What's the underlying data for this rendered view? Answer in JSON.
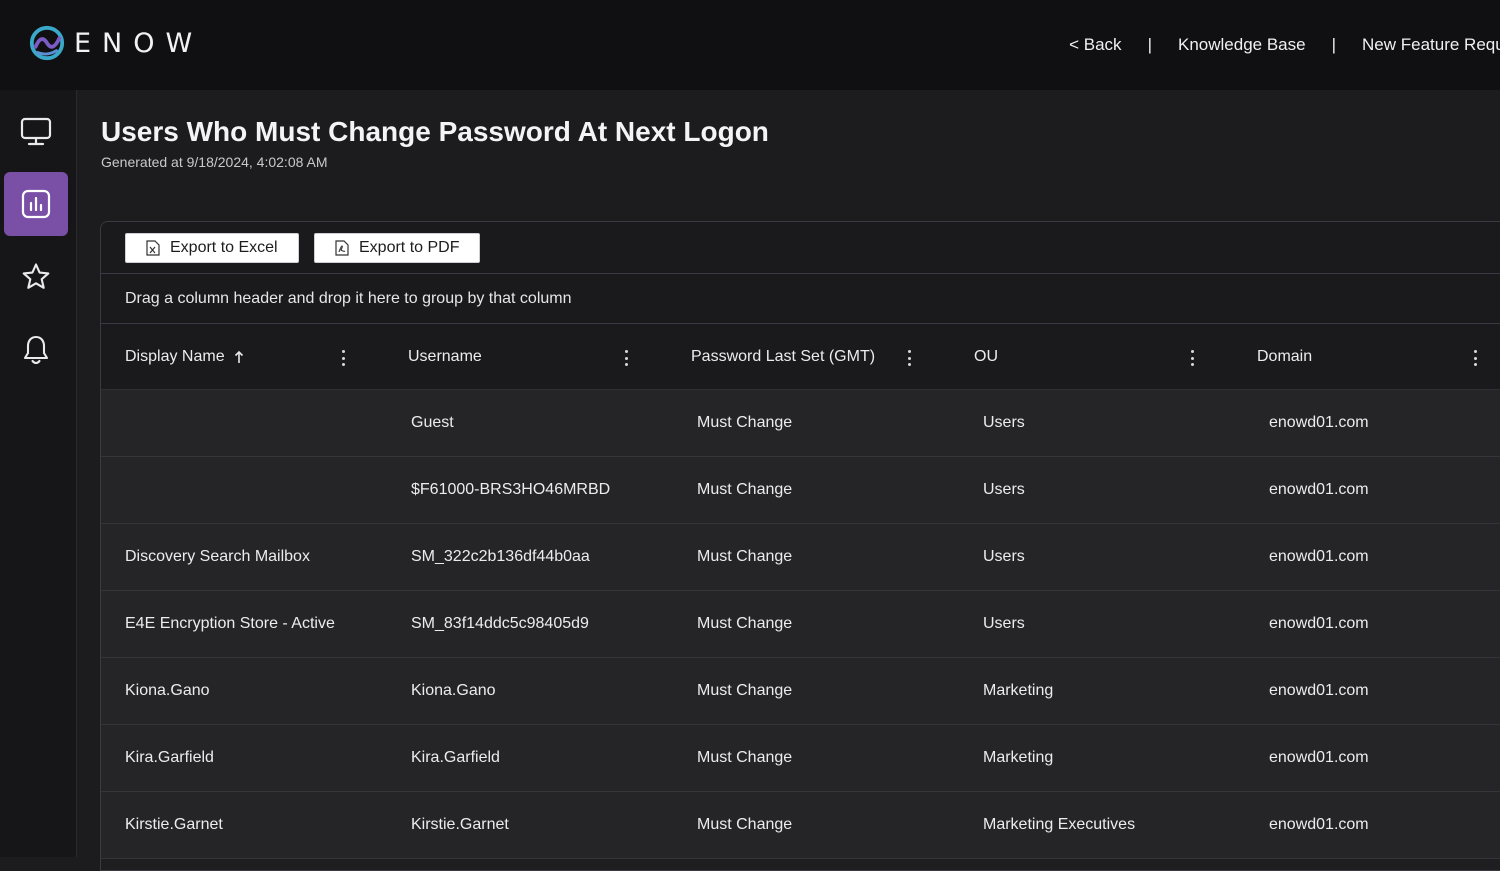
{
  "brand": {
    "name": "ENOW"
  },
  "topnav": {
    "back": "< Back",
    "separator": "|",
    "knowledge_base": "Knowledge Base",
    "feature_request": "New Feature Requ"
  },
  "sidebar": {
    "items": [
      {
        "icon": "monitor-icon",
        "active": false
      },
      {
        "icon": "reports-chart-icon",
        "active": true
      },
      {
        "icon": "star-icon",
        "active": false
      },
      {
        "icon": "bell-icon",
        "active": false
      }
    ],
    "accent": "#7a4fa6"
  },
  "page": {
    "title": "Users Who Must Change Password At Next Logon",
    "subtitle": "Generated at 9/18/2024, 4:02:08 AM"
  },
  "toolbar": {
    "export_excel": "Export to Excel",
    "export_pdf": "Export to PDF"
  },
  "grid": {
    "group_hint": "Drag a column header and drop it here to group by that column",
    "columns": [
      "Display Name",
      "Username",
      "Password Last Set (GMT)",
      "OU",
      "Domain"
    ],
    "sort": {
      "column": "Display Name",
      "direction": "ascending"
    },
    "rows": [
      [
        "",
        "Guest",
        "Must Change",
        "Users",
        "enowd01.com"
      ],
      [
        "",
        "$F61000-BRS3HO46MRBD",
        "Must Change",
        "Users",
        "enowd01.com"
      ],
      [
        "Discovery Search Mailbox",
        "SM_322c2b136df44b0aa",
        "Must Change",
        "Users",
        "enowd01.com"
      ],
      [
        "E4E Encryption Store - Active",
        "SM_83f14ddc5c98405d9",
        "Must Change",
        "Users",
        "enowd01.com"
      ],
      [
        "Kiona.Gano",
        "Kiona.Gano",
        "Must Change",
        "Marketing",
        "enowd01.com"
      ],
      [
        "Kira.Garfield",
        "Kira.Garfield",
        "Must Change",
        "Marketing",
        "enowd01.com"
      ],
      [
        "Kirstie.Garnet",
        "Kirstie.Garnet",
        "Must Change",
        "Marketing Executives",
        "enowd01.com"
      ]
    ]
  }
}
